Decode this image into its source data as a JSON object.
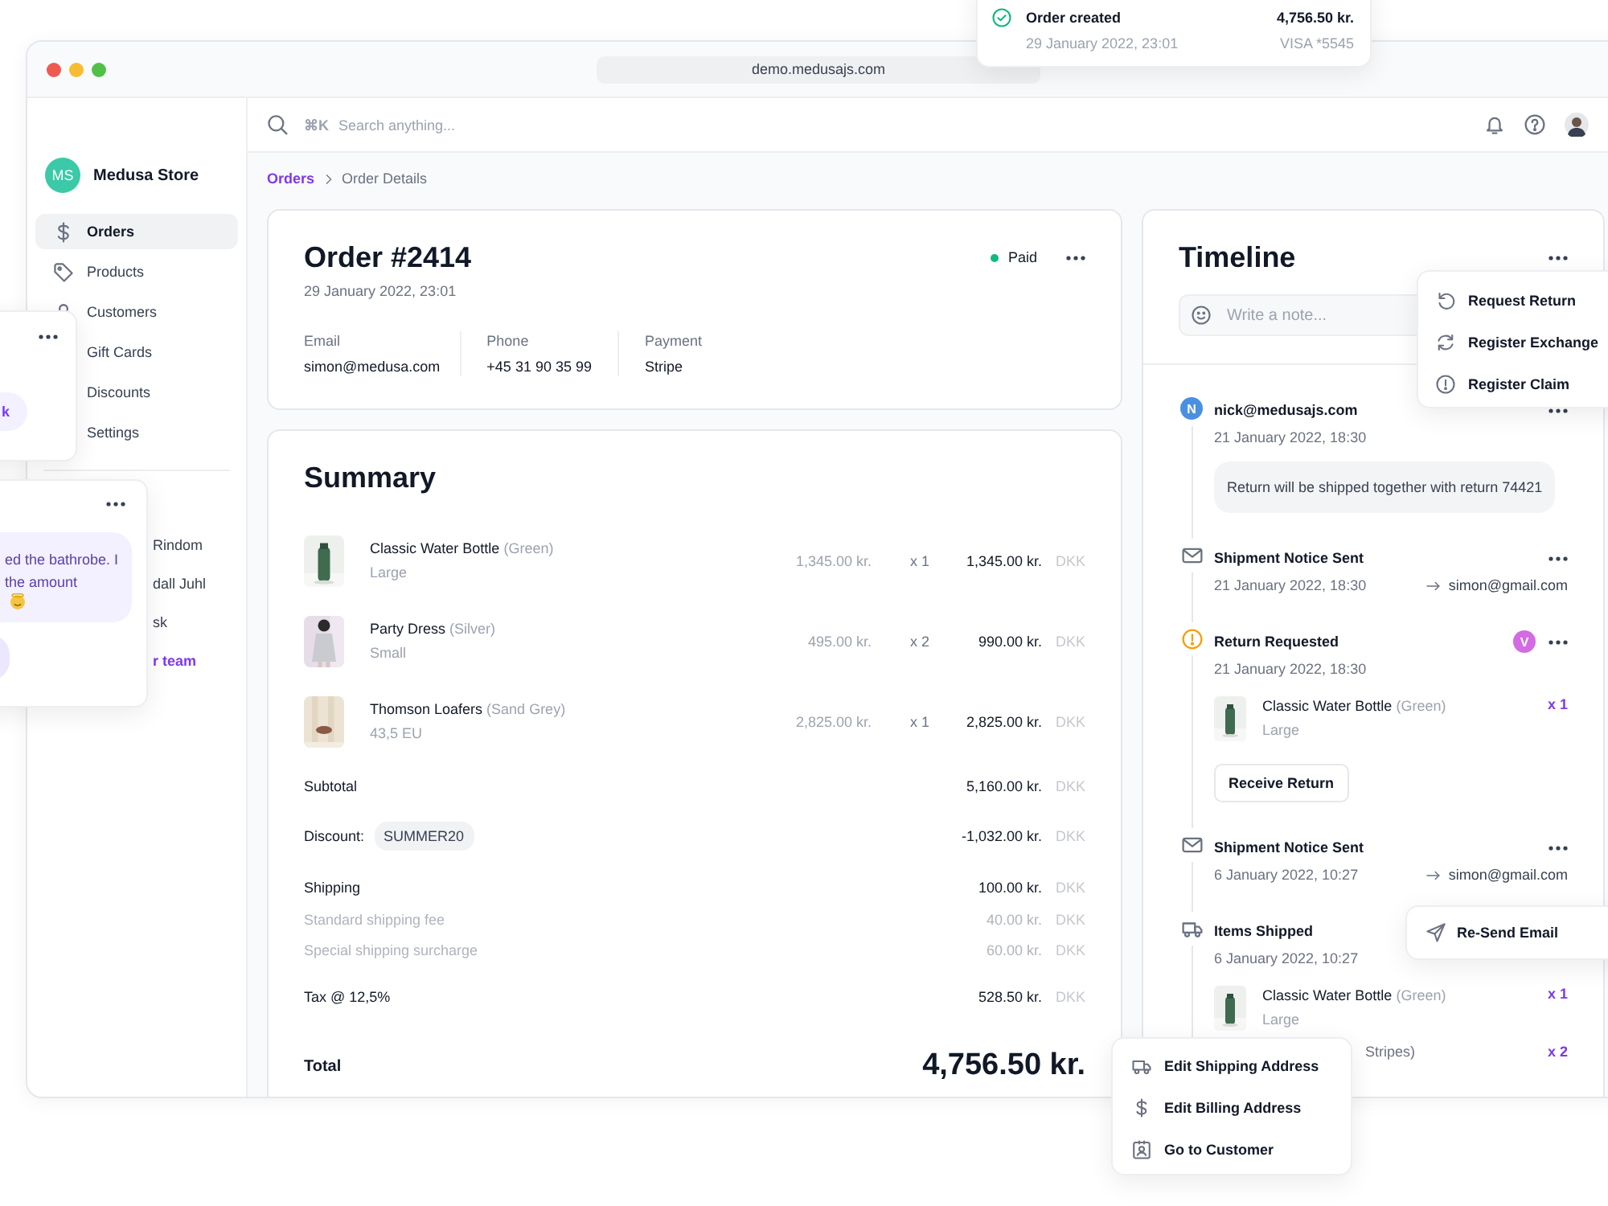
{
  "window": {
    "url": "demo.medusajs.com"
  },
  "sidebar": {
    "store_initials": "MS",
    "store_name": "Medusa Store",
    "items": [
      {
        "label": "Orders",
        "selected": true
      },
      {
        "label": "Products",
        "selected": false
      },
      {
        "label": "Customers",
        "selected": false
      },
      {
        "label": "Gift Cards",
        "selected": false
      },
      {
        "label": "Discounts",
        "selected": false
      },
      {
        "label": "Settings",
        "selected": false
      }
    ],
    "lower_items": [
      {
        "label": "Rindom",
        "kind": "text"
      },
      {
        "label": "dall Juhl",
        "kind": "text"
      },
      {
        "label": "sk",
        "kind": "text"
      },
      {
        "label": "r team",
        "kind": "link"
      }
    ]
  },
  "topbar": {
    "shortcut": "⌘K",
    "search_placeholder": "Search anything..."
  },
  "breadcrumb": {
    "parent": "Orders",
    "current": "Order Details"
  },
  "order": {
    "title": "Order #2414",
    "date": "29 January 2022, 23:01",
    "status": {
      "label": "Paid",
      "color": "#10b981"
    },
    "fields": [
      {
        "label": "Email",
        "value": "simon@medusa.com"
      },
      {
        "label": "Phone",
        "value": "+45 31 90 35 99"
      },
      {
        "label": "Payment",
        "value": "Stripe"
      }
    ]
  },
  "summary": {
    "title": "Summary",
    "items": [
      {
        "name": "Classic Water Bottle",
        "variant": "(Green)",
        "option": "Large",
        "unit_price": "1,345.00 kr.",
        "quantity": "x 1",
        "total": "1,345.00 kr.",
        "currency": "DKK"
      },
      {
        "name": "Party Dress",
        "variant": "(Silver)",
        "option": "Small",
        "unit_price": "495.00 kr.",
        "quantity": "x 2",
        "total": "990.00 kr.",
        "currency": "DKK"
      },
      {
        "name": "Thomson Loafers",
        "variant": "(Sand Grey)",
        "option": "43,5 EU",
        "unit_price": "2,825.00 kr.",
        "quantity": "x 1",
        "total": "2,825.00 kr.",
        "currency": "DKK"
      }
    ],
    "totals": [
      {
        "kind": "subtotal",
        "label": "Subtotal",
        "amount": "5,160.00 kr.",
        "currency": "DKK"
      },
      {
        "kind": "discount",
        "label": "Discount:",
        "code": "SUMMER20",
        "amount": "-1,032.00 kr.",
        "currency": "DKK"
      },
      {
        "kind": "shipping",
        "label": "Shipping",
        "amount": "100.00 kr.",
        "currency": "DKK"
      },
      {
        "kind": "fee",
        "label": "Standard shipping fee",
        "amount": "40.00 kr.",
        "currency": "DKK"
      },
      {
        "kind": "fee",
        "label": "Special shipping surcharge",
        "amount": "60.00 kr.",
        "currency": "DKK"
      },
      {
        "kind": "tax",
        "label": "Tax @ 12,5%",
        "amount": "528.50 kr.",
        "currency": "DKK"
      },
      {
        "kind": "total",
        "label": "Total",
        "amount": "4,756.50 kr."
      }
    ]
  },
  "timeline": {
    "title": "Timeline",
    "note_placeholder": "Write a note...",
    "events": [
      {
        "kind": "note",
        "initial": "N",
        "title": "nick@medusajs.com",
        "time": "21 January 2022, 18:30",
        "note": "Return will be shipped together with return 74421",
        "more_menu": true
      },
      {
        "kind": "email",
        "title": "Shipment Notice Sent",
        "time": "21 January 2022, 18:30",
        "recipient": "simon@gmail.com",
        "more_menu": true
      },
      {
        "kind": "return",
        "title": "Return Requested",
        "time": "21 January 2022, 18:30",
        "user_initial": "V",
        "more_menu": true,
        "items": [
          {
            "kind": "full",
            "name": "Classic Water Bottle",
            "variant": "(Green)",
            "option": "Large",
            "quantity": "x 1"
          }
        ],
        "action": "Receive Return"
      },
      {
        "kind": "email",
        "title": "Shipment Notice Sent",
        "time": "6 January 2022, 10:27",
        "recipient": "simon@gmail.com",
        "more_menu": true
      },
      {
        "kind": "shipped",
        "title": "Items Shipped",
        "time": "6 January 2022, 10:27",
        "more_menu": false,
        "items": [
          {
            "kind": "full",
            "name": "Classic Water Bottle",
            "variant": "(Green)",
            "option": "Large",
            "quantity": "x 1"
          },
          {
            "kind": "cut",
            "name": "Stripes)",
            "quantity": "x 2"
          }
        ]
      }
    ]
  },
  "notification": {
    "title": "Order created",
    "time": "29 January 2022, 23:01",
    "amount": "4,756.50 kr.",
    "card": "VISA *5545"
  },
  "side_cards": [
    {
      "kind": "chip",
      "text": "k"
    },
    {
      "kind": "message",
      "lines": [
        "ed the bathrobe. I",
        "the amount"
      ]
    }
  ],
  "actions_menu": [
    "Request Return",
    "Register Exchange",
    "Register Claim"
  ],
  "resend_popup": "Re-Send Email",
  "address_menu": [
    "Edit Shipping Address",
    "Edit Billing Address",
    "Go to Customer"
  ]
}
